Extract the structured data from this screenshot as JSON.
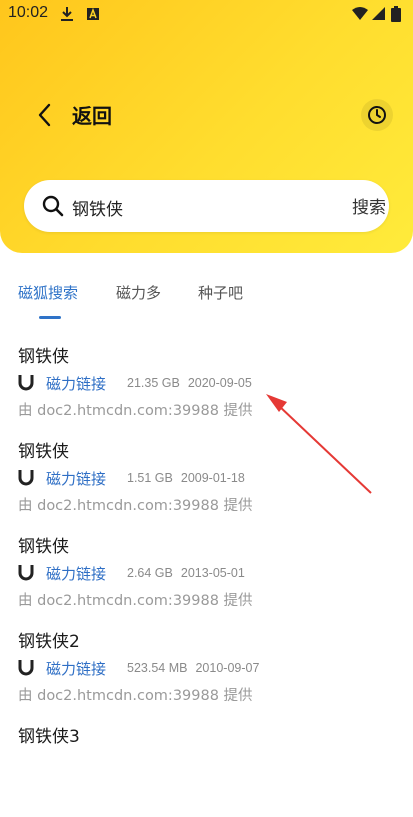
{
  "status_bar": {
    "time": "10:02",
    "icons": [
      "download-icon",
      "app-notification-icon",
      "wifi-icon",
      "signal-icon",
      "battery-icon"
    ]
  },
  "header": {
    "back_label": "返回",
    "back_icon": "chevron-left-icon",
    "history_icon": "clock-icon"
  },
  "search": {
    "query": "钢铁侠",
    "button_label": "搜索"
  },
  "tabs": [
    {
      "label": "磁狐搜索",
      "active": true
    },
    {
      "label": "磁力多",
      "active": false
    },
    {
      "label": "种子吧",
      "active": false
    }
  ],
  "results": [
    {
      "title": "钢铁侠",
      "link_label": "磁力链接",
      "size": "21.35 GB",
      "date": "2020-09-05",
      "provider": "由 doc2.htmcdn.com:39988 提供"
    },
    {
      "title": "钢铁侠",
      "link_label": "磁力链接",
      "size": "1.51 GB",
      "date": "2009-01-18",
      "provider": "由 doc2.htmcdn.com:39988 提供"
    },
    {
      "title": "钢铁侠",
      "link_label": "磁力链接",
      "size": "2.64 GB",
      "date": "2013-05-01",
      "provider": "由 doc2.htmcdn.com:39988 提供"
    },
    {
      "title": "钢铁侠2",
      "link_label": "磁力链接",
      "size": "523.54 MB",
      "date": "2010-09-07",
      "provider": "由 doc2.htmcdn.com:39988 提供"
    },
    {
      "title": "钢铁侠3",
      "link_label": "",
      "size": "",
      "date": "",
      "provider": ""
    }
  ],
  "colors": {
    "header_gradient_start": "#ffc61c",
    "header_gradient_end": "#ffeb3b",
    "accent_blue": "#2f73c8",
    "annotation_arrow": "#e53935"
  }
}
